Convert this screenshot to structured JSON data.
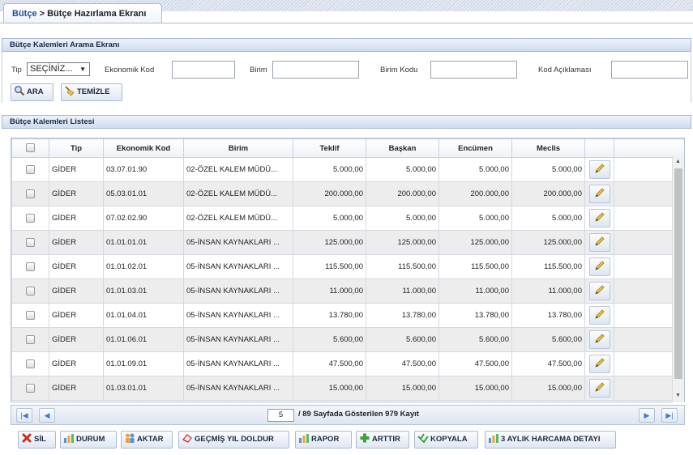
{
  "breadcrumb": {
    "root": "Bütçe",
    "separator": " > ",
    "current": "Bütçe Hazırlama Ekranı"
  },
  "search_panel": {
    "title": "Bütçe Kalemleri Arama Ekranı",
    "tip_label": "Tip",
    "tip_value": "SEÇİNİZ...",
    "ekonomik_kod_label": "Ekonomik Kod",
    "birim_label": "Birim",
    "birim_kodu_label": "Birim Kodu",
    "kod_aciklamasi_label": "Kod Açıklaması",
    "search_button": "ARA",
    "clear_button": "TEMİZLE"
  },
  "list_panel": {
    "title": "Bütçe Kalemleri Listesi"
  },
  "table": {
    "headers": {
      "tip": "Tip",
      "kod": "Ekonomik Kod",
      "birim": "Birim",
      "teklif": "Teklif",
      "baskan": "Başkan",
      "encumen": "Encümen",
      "meclis": "Meclis"
    },
    "rows": [
      {
        "tip": "GİDER",
        "kod": "03.07.01.90",
        "birim": "02-ÖZEL KALEM MÜDÜ...",
        "teklif": "5.000,00",
        "baskan": "5.000,00",
        "encumen": "5.000,00",
        "meclis": "5.000,00"
      },
      {
        "tip": "GİDER",
        "kod": "05.03.01.01",
        "birim": "02-ÖZEL KALEM MÜDÜ...",
        "teklif": "200.000,00",
        "baskan": "200.000,00",
        "encumen": "200.000,00",
        "meclis": "200.000,00"
      },
      {
        "tip": "GİDER",
        "kod": "07.02.02.90",
        "birim": "02-ÖZEL KALEM MÜDÜ...",
        "teklif": "5.000,00",
        "baskan": "5.000,00",
        "encumen": "5.000,00",
        "meclis": "5.000,00"
      },
      {
        "tip": "GİDER",
        "kod": "01.01.01.01",
        "birim": "05-İNSAN KAYNAKLARI ...",
        "teklif": "125.000,00",
        "baskan": "125.000,00",
        "encumen": "125.000,00",
        "meclis": "125.000,00"
      },
      {
        "tip": "GİDER",
        "kod": "01.01.02.01",
        "birim": "05-İNSAN KAYNAKLARI ...",
        "teklif": "115.500,00",
        "baskan": "115.500,00",
        "encumen": "115.500,00",
        "meclis": "115.500,00"
      },
      {
        "tip": "GİDER",
        "kod": "01.01.03.01",
        "birim": "05-İNSAN KAYNAKLARI ...",
        "teklif": "11.000,00",
        "baskan": "11.000,00",
        "encumen": "11.000,00",
        "meclis": "11.000,00"
      },
      {
        "tip": "GİDER",
        "kod": "01.01.04.01",
        "birim": "05-İNSAN KAYNAKLARI ...",
        "teklif": "13.780,00",
        "baskan": "13.780,00",
        "encumen": "13.780,00",
        "meclis": "13.780,00"
      },
      {
        "tip": "GİDER",
        "kod": "01.01.06.01",
        "birim": "05-İNSAN KAYNAKLARI ...",
        "teklif": "5.600,00",
        "baskan": "5.600,00",
        "encumen": "5.600,00",
        "meclis": "5.600,00"
      },
      {
        "tip": "GİDER",
        "kod": "01.01.09.01",
        "birim": "05-İNSAN KAYNAKLARI ...",
        "teklif": "47.500,00",
        "baskan": "47.500,00",
        "encumen": "47.500,00",
        "meclis": "47.500,00"
      },
      {
        "tip": "GİDER",
        "kod": "01.03.01.01",
        "birim": "05-İNSAN KAYNAKLARI ...",
        "teklif": "15.000,00",
        "baskan": "15.000,00",
        "encumen": "15.000,00",
        "meclis": "15.000,00"
      }
    ]
  },
  "pager": {
    "page": "5",
    "info": "/ 89 Sayfada Gösterilen 979 Kayıt"
  },
  "actions": {
    "sil": "SİL",
    "durum": "DURUM",
    "aktar": "AKTAR",
    "gecmis": "GEÇMİŞ YIL DOLDUR",
    "rapor": "RAPOR",
    "arttir": "ARTTIR",
    "kopyala": "KOPYALA",
    "aylik": "3 AYLIK HARCAMA DETAYI"
  },
  "colors": {
    "accent": "#1f4e9a",
    "header_bg": "#dbe5f3",
    "alt_row": "#ededed"
  }
}
